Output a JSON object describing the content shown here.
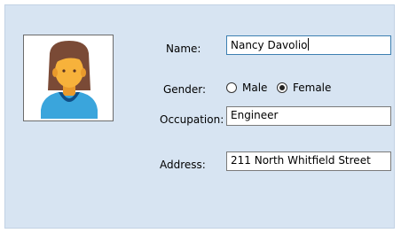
{
  "form": {
    "photo_icon": "person-female-avatar-icon",
    "name": {
      "label": "Name:",
      "value": "Nancy Davolio"
    },
    "gender": {
      "label": "Gender:",
      "options": [
        {
          "label": "Male",
          "checked": false
        },
        {
          "label": "Female",
          "checked": true
        }
      ]
    },
    "occupation": {
      "label": "Occupation:",
      "value": "Engineer"
    },
    "address": {
      "label": "Address:",
      "value": "211 North Whitfield Street"
    }
  },
  "colors": {
    "panel_bg": "#d7e4f2",
    "focus_border": "#3c7fb1",
    "hair": "#7a4a36",
    "skin": "#f7b23b",
    "shirt": "#3aa5dc",
    "collar": "#0f4e86"
  }
}
